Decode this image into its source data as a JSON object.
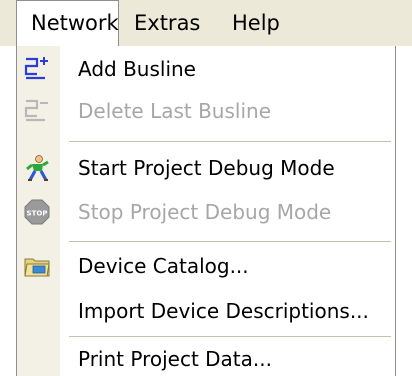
{
  "menubar": {
    "items": [
      {
        "label": "Network"
      },
      {
        "label": "Extras"
      },
      {
        "label": "Help"
      }
    ]
  },
  "menu": {
    "items": [
      {
        "label": "Add Busline",
        "icon": "add-busline-icon",
        "enabled": true
      },
      {
        "label": "Delete Last Busline",
        "icon": "delete-busline-icon",
        "enabled": false
      },
      {
        "label": "Start Project Debug Mode",
        "icon": "running-man-icon",
        "enabled": true
      },
      {
        "label": "Stop Project Debug Mode",
        "icon": "stop-sign-icon",
        "enabled": false
      },
      {
        "label": "Device Catalog...",
        "icon": "folder-catalog-icon",
        "enabled": true
      },
      {
        "label": "Import Device Descriptions...",
        "icon": "",
        "enabled": true
      },
      {
        "label": "Print Project Data...",
        "icon": "",
        "enabled": true
      }
    ]
  },
  "colors": {
    "menubar_bg": "#ece9d8",
    "gutter_bg": "#f3f1e6",
    "disabled_text": "#a7a6aa",
    "busline_blue": "#2b3fd6",
    "stop_gray": "#9a9a9a"
  }
}
